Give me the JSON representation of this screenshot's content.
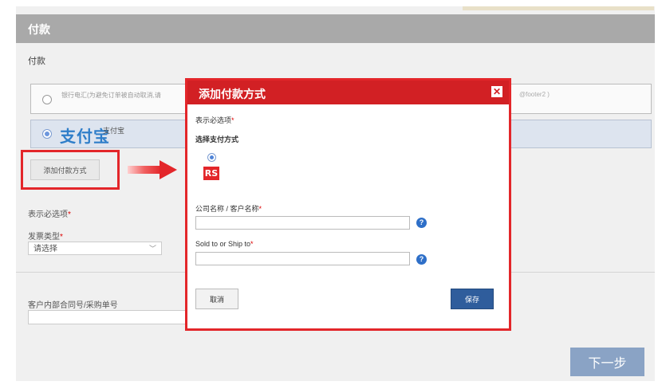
{
  "header": {
    "title": "付款"
  },
  "section": {
    "label": "付款"
  },
  "payment_options": {
    "bank_transfer_text": "银行电汇(为避免订单被自动取消,请",
    "bank_transfer_tail": "@footer2 )",
    "alipay_logo": "支付宝",
    "alipay_label": "支付宝"
  },
  "add_payment_button": "添加付款方式",
  "form": {
    "required_note": "表示必选项",
    "required_star": "*",
    "invoice_type_label": "发票类型",
    "invoice_type_value": "请选择",
    "po_label": "客户内部合同号/采购单号"
  },
  "next_button": "下一步",
  "modal": {
    "title": "添加付款方式",
    "close_symbol": "✕",
    "required_note": "表示必选项",
    "choose_method": "选择支付方式",
    "rs_logo": "RS",
    "company_label": "公司名称 / 客户名称",
    "sold_ship_label": "Sold to or Ship to",
    "help_symbol": "?",
    "cancel_label": "取消",
    "save_label": "保存"
  },
  "colors": {
    "highlight": "#e3262a",
    "modal_header": "#d22024",
    "next_button": "#8aa3c5",
    "save_button": "#2f5d9c"
  }
}
